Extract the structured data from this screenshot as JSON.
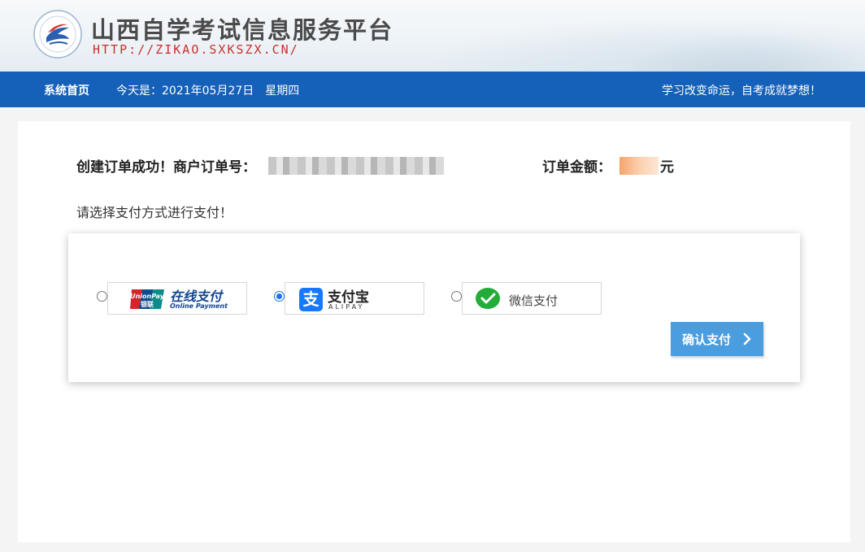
{
  "header": {
    "title": "山西自学考试信息服务平台",
    "url": "HTTP://ZIKAO.SXKSZX.CN/"
  },
  "nav": {
    "home": "系统首页",
    "date_prefix": "今天是：2021年05月27日",
    "weekday": "星期四",
    "slogan": "学习改变命运，自考成就梦想！"
  },
  "order": {
    "success_text": "创建订单成功！商户订单号：",
    "amount_label": "订单金额：",
    "amount_unit": "元",
    "choose_text": "请选择支付方式进行支付！"
  },
  "payment_options": [
    {
      "name": "unionpay",
      "label_cn": "在线支付",
      "label_en": "Online Payment",
      "logo_text": "UnionPay 银联",
      "selected": false
    },
    {
      "name": "alipay",
      "label_cn": "支付宝",
      "label_en": "ALIPAY",
      "icon_glyph": "支",
      "selected": true
    },
    {
      "name": "wechat",
      "label_cn": "微信支付",
      "selected": false
    }
  ],
  "confirm_button": {
    "label": "确认支付"
  },
  "colors": {
    "nav": "#1560b8",
    "button": "#4a9ee0",
    "url": "#c8302c"
  }
}
